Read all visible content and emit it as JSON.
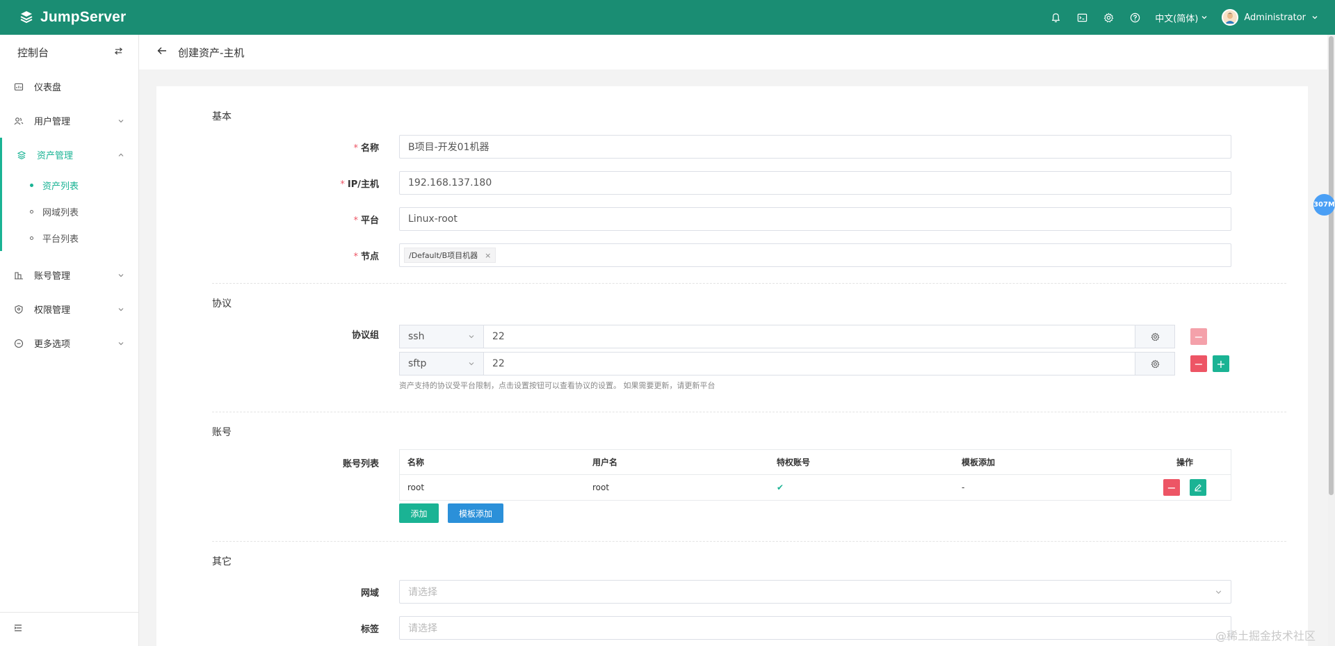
{
  "topbar": {
    "logo_text": "JumpServer",
    "language": "中文(简体)",
    "user_name": "Administrator"
  },
  "sidebar": {
    "title": "控制台",
    "menu": [
      {
        "label": "仪表盘",
        "icon": "dashboard-icon"
      },
      {
        "label": "用户管理",
        "icon": "users-icon"
      },
      {
        "label": "资产管理",
        "icon": "assets-icon",
        "active": true,
        "children": [
          {
            "label": "资产列表",
            "active": true
          },
          {
            "label": "网域列表"
          },
          {
            "label": "平台列表"
          }
        ]
      },
      {
        "label": "账号管理",
        "icon": "accounts-icon"
      },
      {
        "label": "权限管理",
        "icon": "permissions-icon"
      },
      {
        "label": "更多选项",
        "icon": "more-icon"
      }
    ]
  },
  "page": {
    "title": "创建资产-主机"
  },
  "form": {
    "basic": {
      "section": "基本",
      "name_label": "名称",
      "name_value": "B项目-开发01机器",
      "ip_label": "IP/主机",
      "ip_value": "192.168.137.180",
      "platform_label": "平台",
      "platform_value": "Linux-root",
      "node_label": "节点",
      "node_tag": "/Default/B项目机器"
    },
    "protocol": {
      "section": "协议",
      "group_label": "协议组",
      "rows": [
        {
          "protocol": "ssh",
          "port": "22"
        },
        {
          "protocol": "sftp",
          "port": "22"
        }
      ],
      "hint": "资产支持的协议受平台限制，点击设置按钮可以查看协议的设置。 如果需要更新，请更新平台"
    },
    "account": {
      "section": "账号",
      "list_label": "账号列表",
      "columns": [
        "名称",
        "用户名",
        "特权账号",
        "模板添加",
        "操作"
      ],
      "rows": [
        {
          "name": "root",
          "username": "root",
          "privileged": "✔",
          "template": "-"
        }
      ],
      "add_button": "添加",
      "template_add_button": "模板添加"
    },
    "other": {
      "section": "其它",
      "domain_label": "网域",
      "domain_placeholder": "请选择",
      "labels_label": "标签",
      "labels_placeholder": "请选择"
    }
  },
  "overlay": {
    "memory_badge": "307M",
    "watermark": "@稀土掘金技术社区"
  },
  "colors": {
    "topbar": "#1a8d73",
    "accent": "#1ab394",
    "danger": "#ed5565",
    "info": "#2b90d9"
  }
}
